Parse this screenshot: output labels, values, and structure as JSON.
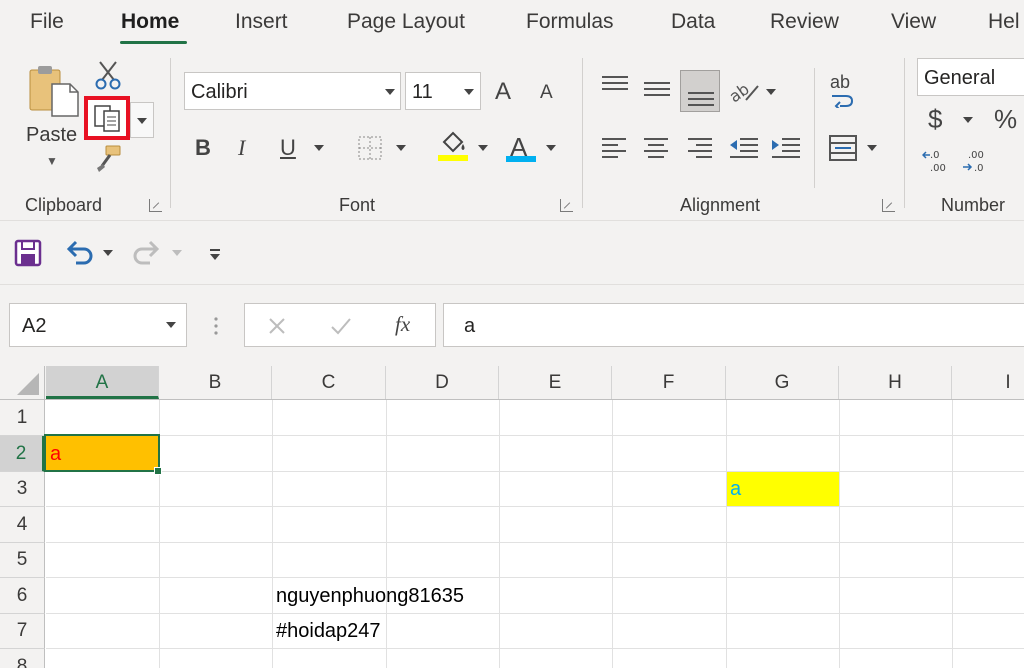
{
  "tabs": [
    "File",
    "Home",
    "Insert",
    "Page Layout",
    "Formulas",
    "Data",
    "Review",
    "View",
    "Hel"
  ],
  "active_tab": "Home",
  "ribbon": {
    "clipboard": {
      "label": "Clipboard",
      "paste_label": "Paste"
    },
    "font": {
      "label": "Font",
      "font_name": "Calibri",
      "font_size": "11",
      "bold": "B",
      "italic": "I",
      "underline": "U",
      "grow": "A",
      "shrink": "A",
      "font_color_glyph": "A"
    },
    "alignment": {
      "label": "Alignment",
      "wrap_glyph": "ab"
    },
    "number": {
      "label": "Number",
      "format": "General",
      "currency": "$",
      "percent": "%"
    }
  },
  "formula_bar": {
    "name_box": "A2",
    "fx_glyph": "fx",
    "content": "a"
  },
  "columns": [
    "A",
    "B",
    "C",
    "D",
    "E",
    "F",
    "G",
    "H",
    "I"
  ],
  "rows": [
    "1",
    "2",
    "3",
    "4",
    "5",
    "6",
    "7",
    "8"
  ],
  "selected_cell": "A2",
  "cells": {
    "A2": {
      "value": "a",
      "fill": "#ffc000",
      "color": "#ff0000"
    },
    "G3": {
      "value": "a",
      "fill": "#ffff00",
      "color": "#00b0f0"
    },
    "C6": {
      "value": "nguyenphuong81635"
    },
    "C7": {
      "value": "#hoidap247"
    }
  },
  "colors": {
    "accent": "#217346",
    "highlight_border": "#e81123",
    "fill_swatch": "#ffff00",
    "font_color_swatch": "#00b0f0"
  }
}
